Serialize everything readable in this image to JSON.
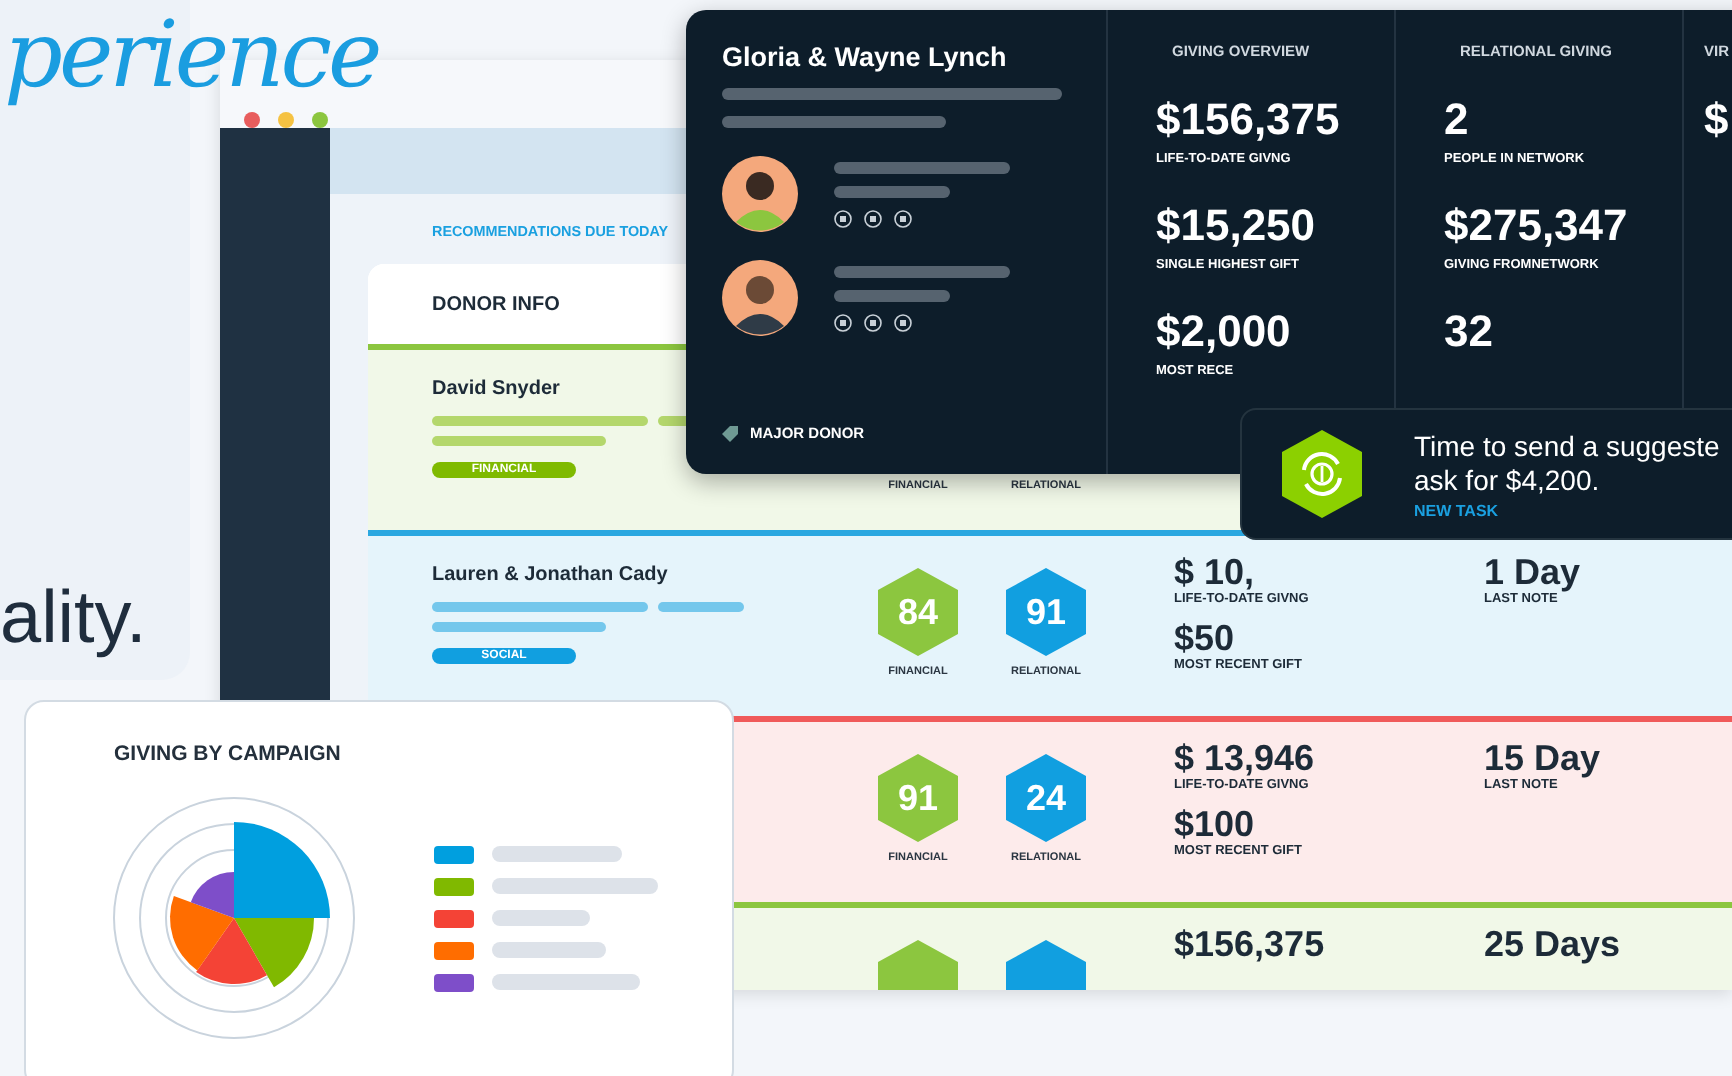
{
  "hero": {
    "script_word": "perience",
    "tagline": "ality."
  },
  "app_window": {
    "section_title": "RECOMMENDATIONS DUE TODAY",
    "table_header": "DONOR INFO",
    "rows": [
      {
        "color": "#8cc63f",
        "name": "David Snyder",
        "tag": {
          "label": "FINANCIAL",
          "color": "#7fba00"
        },
        "scores": [
          {
            "kind": "financial",
            "label": "FINANCIAL"
          },
          {
            "kind": "relational",
            "label": "RELATIONAL"
          }
        ],
        "amounts": [],
        "notes": []
      },
      {
        "color": "#2aa7e0",
        "name": "Lauren & Jonathan Cady",
        "tag": {
          "label": "SOCIAL",
          "color": "#119fe0"
        },
        "scores": [
          {
            "kind": "financial",
            "value": "84",
            "label": "FINANCIAL"
          },
          {
            "kind": "relational",
            "value": "91",
            "label": "RELATIONAL"
          }
        ],
        "amounts": [
          {
            "value": "$ 10,",
            "label": "LIFE-TO-DATE GIVNG"
          },
          {
            "value": "$50",
            "label": "MOST RECENT GIFT"
          }
        ],
        "notes": [
          {
            "value": "1 Day",
            "label": "LAST NOTE"
          }
        ]
      },
      {
        "color": "#f05a5a",
        "scores": [
          {
            "kind": "financial",
            "value": "91",
            "label": "FINANCIAL"
          },
          {
            "kind": "relational",
            "value": "24",
            "label": "RELATIONAL"
          }
        ],
        "amounts": [
          {
            "value": "$ 13,946",
            "label": "LIFE-TO-DATE GIVNG"
          },
          {
            "value": "$100",
            "label": "MOST RECENT GIFT"
          }
        ],
        "notes": [
          {
            "value": "15 Day",
            "label": "LAST NOTE"
          }
        ]
      },
      {
        "color": "#8cc63f",
        "scores": [
          {
            "kind": "financial"
          },
          {
            "kind": "relational"
          }
        ],
        "amounts": [
          {
            "value": "$156,375"
          }
        ],
        "notes": [
          {
            "value": "25 Days"
          }
        ]
      }
    ]
  },
  "donor_card": {
    "name": "Gloria & Wayne Lynch",
    "badge": "MAJOR DONOR",
    "columns": [
      {
        "heading": "GIVING OVERVIEW",
        "stats": [
          {
            "value": "$156,375",
            "label": "LIFE-TO-DATE GIVNG"
          },
          {
            "value": "$15,250",
            "label": "SINGLE  HIGHEST GIFT"
          },
          {
            "value": "$2,000",
            "label": "MOST RECE"
          }
        ]
      },
      {
        "heading": "RELATIONAL GIVING",
        "stats": [
          {
            "value": "2",
            "label": "PEOPLE IN NETWORK"
          },
          {
            "value": "$275,347",
            "label": "GIVING FROMNETWORK"
          },
          {
            "value": "32"
          }
        ]
      },
      {
        "heading": "VIR",
        "stats": [
          {
            "value": "$"
          }
        ]
      }
    ]
  },
  "toast": {
    "lines": [
      "Time to send a suggeste",
      "ask for $4,200."
    ],
    "link": "NEW TASK"
  },
  "campaign_card": {
    "title": "GIVING BY CAMPAIGN",
    "legend": [
      {
        "color": "#009fdf"
      },
      {
        "color": "#80b900"
      },
      {
        "color": "#f44336"
      },
      {
        "color": "#ff6d00"
      },
      {
        "color": "#7e4ec9"
      }
    ]
  }
}
